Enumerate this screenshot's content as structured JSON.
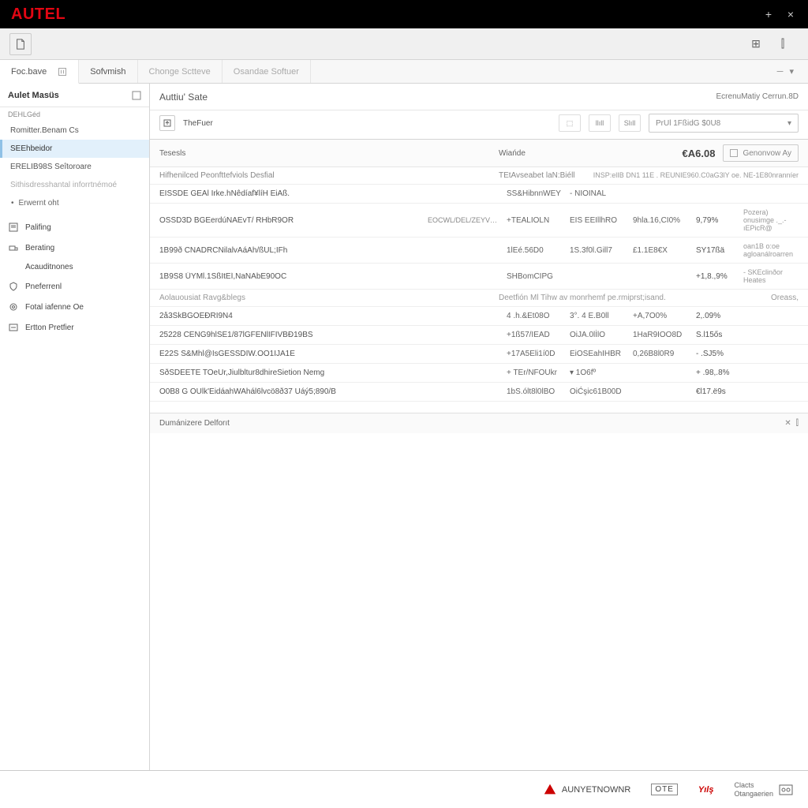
{
  "titlebar": {
    "logo": "AUTEL"
  },
  "toolbar_icons": {
    "right1": "⊞",
    "right2": "⫿"
  },
  "tabs": [
    {
      "label": "Foc.bave",
      "active": true,
      "icon": true
    },
    {
      "label": "Sofvmish",
      "active": false,
      "dim": false
    },
    {
      "label": "Chonge Sctteve",
      "active": false,
      "dim": true
    },
    {
      "label": "Osandae Softuer",
      "active": false,
      "dim": true
    }
  ],
  "tabbar_right": {
    "dash": "─",
    "chev": "▾"
  },
  "sidebar": {
    "header": "Aulet Masüs",
    "sub": "DEHLGéd",
    "items": [
      {
        "label": "Romitter.Benam Cs",
        "sel": false
      },
      {
        "label": "SEEhbeidor",
        "sel": true
      },
      {
        "label": "ERELIB98S Seîtoroare",
        "sel": false
      },
      {
        "label": "Sithisdresshantal inforrtnémoé",
        "sel": false,
        "muted": true
      }
    ],
    "bullet": "Erwernt oht",
    "icon_items": [
      {
        "icon": "page",
        "label": "Palifing"
      },
      {
        "icon": "truck",
        "label": "Berating"
      },
      {
        "icon": "blank",
        "label": "Acauditnones"
      },
      {
        "icon": "shield",
        "label": "Pneferrenl"
      },
      {
        "icon": "gear",
        "label": "Fotal iafenne Oe"
      },
      {
        "icon": "pref",
        "label": "Ertton Pretfier"
      }
    ]
  },
  "page": {
    "title": "Auttiu' Sate",
    "right_label": "EcrenuMatiy Cerrun.8D",
    "filter_label": "TheFuer",
    "mini1": "⬚",
    "mini2": "llıll",
    "mini3": "Slıll",
    "dropdown": "PrUl 1FßidG $0U8"
  },
  "table": {
    "head_left": "Tesesls",
    "head_mid": "Wiańde",
    "metric": "€A6.08",
    "check_label": "Genonvow  Ay",
    "subhead_left": "Hifhenilced Peonfttefviols Desfial",
    "subhead_mid": "TEtAvseabet laN:Biéll",
    "subhead_right": "INSP:elIB DN1 11E . REUNIE960.C0aG3lY oe. NE-1E80nranníer",
    "rows": [
      {
        "c1": "EISSDE GEAl Irke.hNêdíaf¥líH EiAß.",
        "c2": "",
        "c3": "SS&HibnnWEY",
        "c4": "- NIOINAL",
        "c5": "",
        "c6": "",
        "c7": ""
      },
      {
        "c1": "OSSD3D BGEerdúNAEvT/ RHbR9OR",
        "c2": "EOCWL/DEL/ZEYV…",
        "c3": "+TEALIOLN",
        "c4": "EIS EEIllhRO",
        "c5": "9hla.16,CI0%",
        "c6": "9,79%",
        "c7": "Pozera) onusimge ._.- ıEPicR@"
      },
      {
        "c1": "1B99ð CNADRCNilalvAáAh/ßUL;IFh",
        "c2": "",
        "c3": "1lEé.56D0",
        "c4": "1S.3f0l.Gill7",
        "c5": "£1.1E8€X",
        "c6": "SY17ßä",
        "c7": "oan1B o:oe agloanálroarren"
      },
      {
        "c1": "1B9S8 ÜYMl.1SßItEÍ,NaNAbE90OC",
        "c2": "",
        "c3": "SHBomCIPG",
        "c4": "",
        "c5": "",
        "c6": "+1,8.,9%",
        "c7": "- SKEclinðor Heates"
      },
      {
        "c1": "2å3SkBGOEÐRI9N4",
        "c2": "",
        "c3": "4 .h.&Et08O",
        "c4": "3°. 4 E.B0ll",
        "c5": "+A,7O0%",
        "c6": "2,.09%",
        "c7": ""
      },
      {
        "c1": "25228 CENG9hlSE1/87lGFENlIFIVBÐ19BS",
        "c2": "",
        "c3": "+1ß57/IEAD",
        "c4": "OiJA.0lİlO",
        "c5": "1HaR9IOO8D",
        "c6": "S.l15ős",
        "c7": ""
      },
      {
        "c1": "E22S S&Mhl@IsGESSDIW.OO1IJA1E",
        "c2": "",
        "c3": "+17A5Eli1í0D",
        "c4": "EiOSEahIHBR",
        "c5": "0,26B8l0R9",
        "c6": "- .SJ5%",
        "c7": ""
      },
      {
        "c1": "SðSDEETE TOeUr,Jiulbltur8dhireSietion Nemg",
        "c2": "",
        "c3": "+ TEr/NFOUkr",
        "c4": "▾  1O6fº",
        "c5": "",
        "c6": "+ .98,.8%",
        "c7": ""
      },
      {
        "c1": "O0B8 G OUlk'EidáahWAhál6lvcö8ð37 Uáý5;890/B",
        "c2": "",
        "c3": "1bS.ólt8l0lBO",
        "c4": "OiĆşic61B00D",
        "c5": "",
        "c6": "€l17.ë9s",
        "c7": ""
      }
    ],
    "section": {
      "left": "Aolauousiat Ravg&blegs",
      "mid": "Deetfión Ml Tihw av monrhemf pe.rmiprst;isand.",
      "right": "Oreass,"
    },
    "footer_left": "Dumánizere Delforıt",
    "footer_r1": "✕",
    "footer_r2": "⫿"
  },
  "status": {
    "brand1": "AUNYETNOWNR",
    "brand2": "OTE",
    "brand3": "Yılş",
    "brand4a": "Clacts",
    "brand4b": "Otangaerien"
  }
}
